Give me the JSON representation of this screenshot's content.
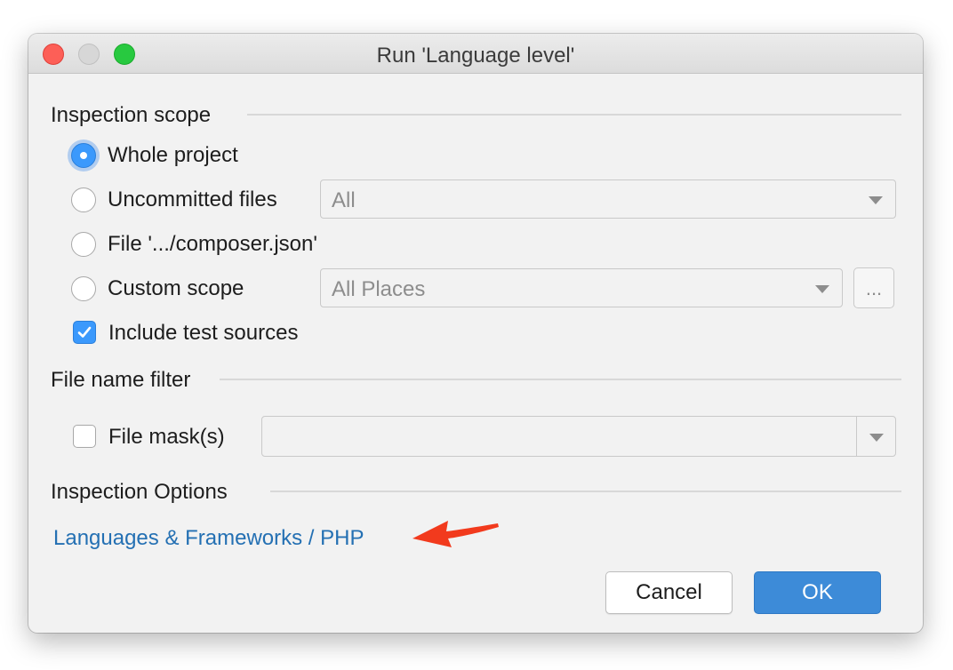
{
  "window": {
    "title": "Run 'Language level'"
  },
  "inspection_scope": {
    "label": "Inspection scope",
    "options": [
      {
        "label": "Whole project",
        "selected": true
      },
      {
        "label": "Uncommitted files",
        "selected": false,
        "dropdown_value": "All"
      },
      {
        "label": "File '.../composer.json'",
        "selected": false
      },
      {
        "label": "Custom scope",
        "selected": false,
        "dropdown_value": "All Places",
        "browse_label": "..."
      }
    ],
    "include_test_sources": {
      "label": "Include test sources",
      "checked": true
    }
  },
  "file_name_filter": {
    "label": "File name filter",
    "file_mask": {
      "label": "File mask(s)",
      "checked": false,
      "value": ""
    }
  },
  "inspection_options": {
    "label": "Inspection Options",
    "link": "Languages & Frameworks / PHP"
  },
  "buttons": {
    "cancel": "Cancel",
    "ok": "OK"
  },
  "colors": {
    "accent": "#3b99fc",
    "link": "#2470b3",
    "annotation_arrow": "#f23a1d"
  },
  "icons": [
    "close-icon",
    "minimize-icon",
    "maximize-icon",
    "chevron-down-icon",
    "checkmark-icon",
    "annotation-arrow-icon"
  ]
}
